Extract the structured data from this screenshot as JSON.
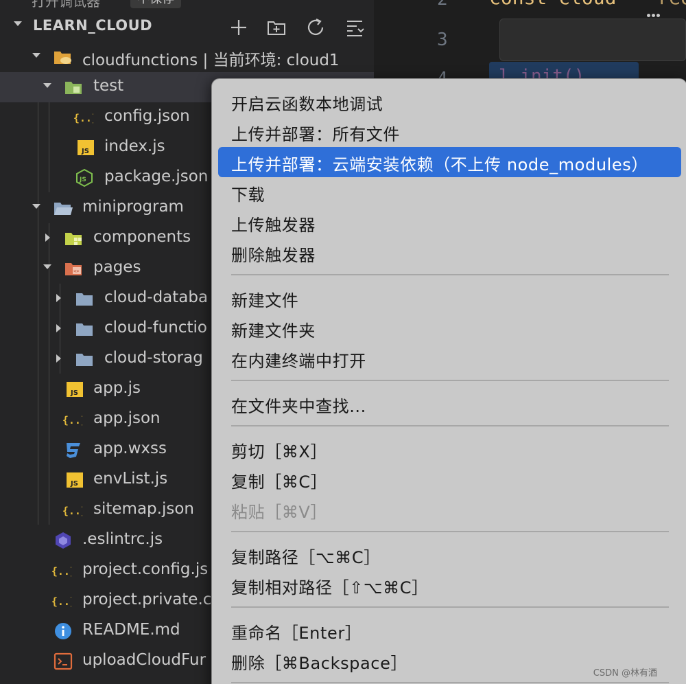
{
  "top_strip": {
    "cut_text": "打开调试器",
    "pill_text": "不保存"
  },
  "explorer": {
    "section_title": "LEARN_CLOUD",
    "actions": [
      "new-file",
      "new-folder",
      "refresh",
      "collapse-all"
    ],
    "tree": [
      {
        "label": "cloudfunctions | 当前环境: cloud1",
        "icon": "cloud-folder-icon",
        "expanded": true
      },
      {
        "label": "test",
        "icon": "green-folder-icon",
        "expanded": true,
        "selected": true
      },
      {
        "label": "config.json",
        "icon": "json-icon"
      },
      {
        "label": "index.js",
        "icon": "js-icon"
      },
      {
        "label": "package.json",
        "icon": "node-icon"
      },
      {
        "label": "miniprogram",
        "icon": "folder-open-icon",
        "expanded": true
      },
      {
        "label": "components",
        "icon": "components-folder-icon",
        "expanded": false
      },
      {
        "label": "pages",
        "icon": "pages-folder-icon",
        "expanded": true
      },
      {
        "label": "cloud-databa",
        "icon": "folder-icon",
        "expanded": false
      },
      {
        "label": "cloud-functio",
        "icon": "folder-icon",
        "expanded": false
      },
      {
        "label": "cloud-storag",
        "icon": "folder-icon",
        "expanded": false
      },
      {
        "label": "app.js",
        "icon": "js-icon"
      },
      {
        "label": "app.json",
        "icon": "json-icon"
      },
      {
        "label": "app.wxss",
        "icon": "css-icon"
      },
      {
        "label": "envList.js",
        "icon": "js-icon"
      },
      {
        "label": "sitemap.json",
        "icon": "json-icon"
      },
      {
        "label": ".eslintrc.js",
        "icon": "eslint-icon"
      },
      {
        "label": "project.config.js",
        "icon": "json-icon"
      },
      {
        "label": "project.private.c",
        "icon": "json-icon"
      },
      {
        "label": "README.md",
        "icon": "info-icon"
      },
      {
        "label": "uploadCloudFur",
        "icon": "terminal-icon"
      }
    ]
  },
  "editor": {
    "line_numbers": [
      "2",
      "3",
      "4"
    ],
    "code_fragment": "const cloud",
    "code_fragment_2": "req",
    "blue_fragment": "l.init()"
  },
  "context_menu": {
    "items": [
      {
        "label": "开启云函数本地调试"
      },
      {
        "label": "上传并部署：所有文件"
      },
      {
        "label": "上传并部署：云端安装依赖（不上传 node_modules）",
        "highlighted": true
      },
      {
        "label": "下载"
      },
      {
        "label": "上传触发器"
      },
      {
        "label": "删除触发器"
      },
      {
        "label": "新建文件"
      },
      {
        "label": "新建文件夹"
      },
      {
        "label": "在内建终端中打开"
      },
      {
        "label": "在文件夹中查找..."
      },
      {
        "label": "剪切［⌘X］"
      },
      {
        "label": "复制［⌘C］"
      },
      {
        "label": "粘贴［⌘V］",
        "disabled": true
      },
      {
        "label": "复制路径［⌥⌘C］"
      },
      {
        "label": "复制相对路径［⇧⌥⌘C］"
      },
      {
        "label": "重命名［Enter］"
      },
      {
        "label": "删除［⌘Backspace］"
      }
    ]
  },
  "watermark": "CSDN @林有酒",
  "colors": {
    "sidebar_bg": "#252526",
    "selection_bg": "#37373d",
    "menu_bg": "#c9c9c9",
    "menu_highlight": "#2f6fd8",
    "folder": "#8fa6c2",
    "json": "#e2b93b",
    "js": "#f1c232"
  }
}
